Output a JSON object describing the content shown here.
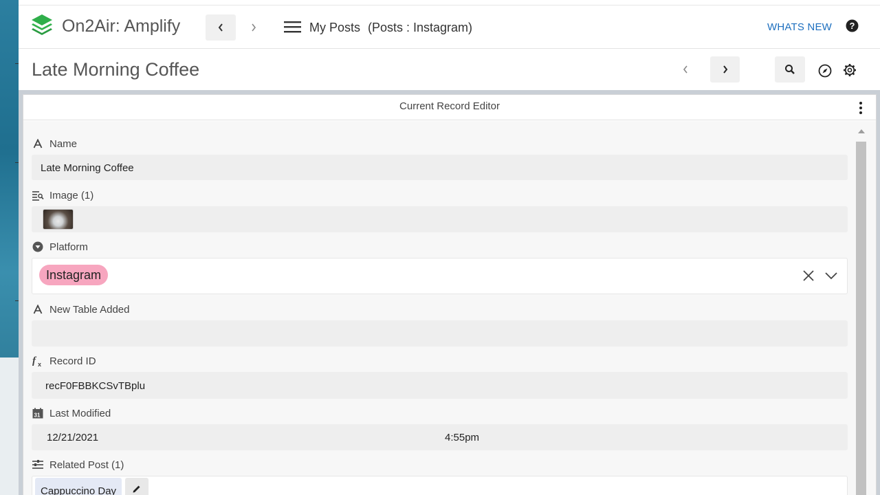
{
  "app": {
    "title": "On2Air: Amplify",
    "logo_icon": "stacked-layers-icon",
    "brand_color": "#2fae4a"
  },
  "header": {
    "breadcrumb_main": "My Posts",
    "breadcrumb_sub": "(Posts : Instagram)",
    "whats_new_label": "WHATS NEW",
    "accent_color": "#1d6fbf"
  },
  "record": {
    "title": "Late Morning Coffee"
  },
  "editor": {
    "title": "Current Record Editor",
    "fields": {
      "name": {
        "label": "Name",
        "value": "Late Morning Coffee",
        "icon": "text-icon"
      },
      "image": {
        "label": "Image (1)",
        "icon": "attachment-icon",
        "thumbnail": "coffee-cup-thumbnail"
      },
      "platform": {
        "label": "Platform",
        "icon": "single-select-icon",
        "selected": "Instagram",
        "chip_color": "#f7a6bf"
      },
      "new_table_added": {
        "label": "New Table Added",
        "value": "",
        "icon": "text-icon"
      },
      "record_id": {
        "label": "Record ID",
        "value": "recF0FBBKCSvTBplu",
        "icon": "formula-icon"
      },
      "last_modified": {
        "label": "Last Modified",
        "date": "12/21/2021",
        "time": "4:55pm",
        "icon": "calendar-icon"
      },
      "related_post": {
        "label": "Related Post (1)",
        "icon": "link-icon",
        "linked": "Cappuccino Day"
      }
    }
  }
}
